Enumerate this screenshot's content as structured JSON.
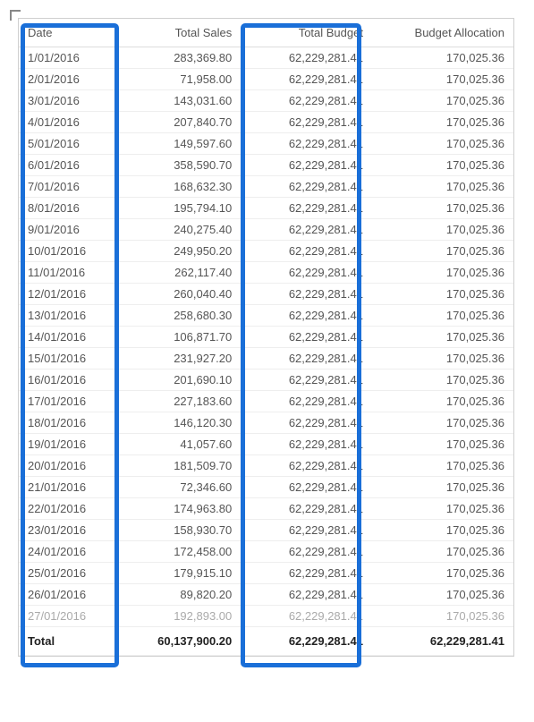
{
  "chart_data": {
    "type": "table",
    "title": "",
    "columns": [
      "Date",
      "Total Sales",
      "Total Budget",
      "Budget Allocation"
    ],
    "rows": [
      [
        "1/01/2016",
        "283,369.80",
        "62,229,281.41",
        "170,025.36"
      ],
      [
        "2/01/2016",
        "71,958.00",
        "62,229,281.41",
        "170,025.36"
      ],
      [
        "3/01/2016",
        "143,031.60",
        "62,229,281.41",
        "170,025.36"
      ],
      [
        "4/01/2016",
        "207,840.70",
        "62,229,281.41",
        "170,025.36"
      ],
      [
        "5/01/2016",
        "149,597.60",
        "62,229,281.41",
        "170,025.36"
      ],
      [
        "6/01/2016",
        "358,590.70",
        "62,229,281.41",
        "170,025.36"
      ],
      [
        "7/01/2016",
        "168,632.30",
        "62,229,281.41",
        "170,025.36"
      ],
      [
        "8/01/2016",
        "195,794.10",
        "62,229,281.41",
        "170,025.36"
      ],
      [
        "9/01/2016",
        "240,275.40",
        "62,229,281.41",
        "170,025.36"
      ],
      [
        "10/01/2016",
        "249,950.20",
        "62,229,281.41",
        "170,025.36"
      ],
      [
        "11/01/2016",
        "262,117.40",
        "62,229,281.41",
        "170,025.36"
      ],
      [
        "12/01/2016",
        "260,040.40",
        "62,229,281.41",
        "170,025.36"
      ],
      [
        "13/01/2016",
        "258,680.30",
        "62,229,281.41",
        "170,025.36"
      ],
      [
        "14/01/2016",
        "106,871.70",
        "62,229,281.41",
        "170,025.36"
      ],
      [
        "15/01/2016",
        "231,927.20",
        "62,229,281.41",
        "170,025.36"
      ],
      [
        "16/01/2016",
        "201,690.10",
        "62,229,281.41",
        "170,025.36"
      ],
      [
        "17/01/2016",
        "227,183.60",
        "62,229,281.41",
        "170,025.36"
      ],
      [
        "18/01/2016",
        "146,120.30",
        "62,229,281.41",
        "170,025.36"
      ],
      [
        "19/01/2016",
        "41,057.60",
        "62,229,281.41",
        "170,025.36"
      ],
      [
        "20/01/2016",
        "181,509.70",
        "62,229,281.41",
        "170,025.36"
      ],
      [
        "21/01/2016",
        "72,346.60",
        "62,229,281.41",
        "170,025.36"
      ],
      [
        "22/01/2016",
        "174,963.80",
        "62,229,281.41",
        "170,025.36"
      ],
      [
        "23/01/2016",
        "158,930.70",
        "62,229,281.41",
        "170,025.36"
      ],
      [
        "24/01/2016",
        "172,458.00",
        "62,229,281.41",
        "170,025.36"
      ],
      [
        "25/01/2016",
        "179,915.10",
        "62,229,281.41",
        "170,025.36"
      ],
      [
        "26/01/2016",
        "89,820.20",
        "62,229,281.41",
        "170,025.36"
      ],
      [
        "27/01/2016",
        "192,893.00",
        "62,229,281.41",
        "170,025.36"
      ]
    ],
    "totals": [
      "Total",
      "60,137,900.20",
      "62,229,281.41",
      "62,229,281.41"
    ]
  },
  "headers": {
    "date": "Date",
    "sales": "Total Sales",
    "budget": "Total Budget",
    "alloc": "Budget Allocation"
  },
  "footer": {
    "label": "Total",
    "sales": "60,137,900.20",
    "budget": "62,229,281.41",
    "alloc": "62,229,281.41"
  }
}
